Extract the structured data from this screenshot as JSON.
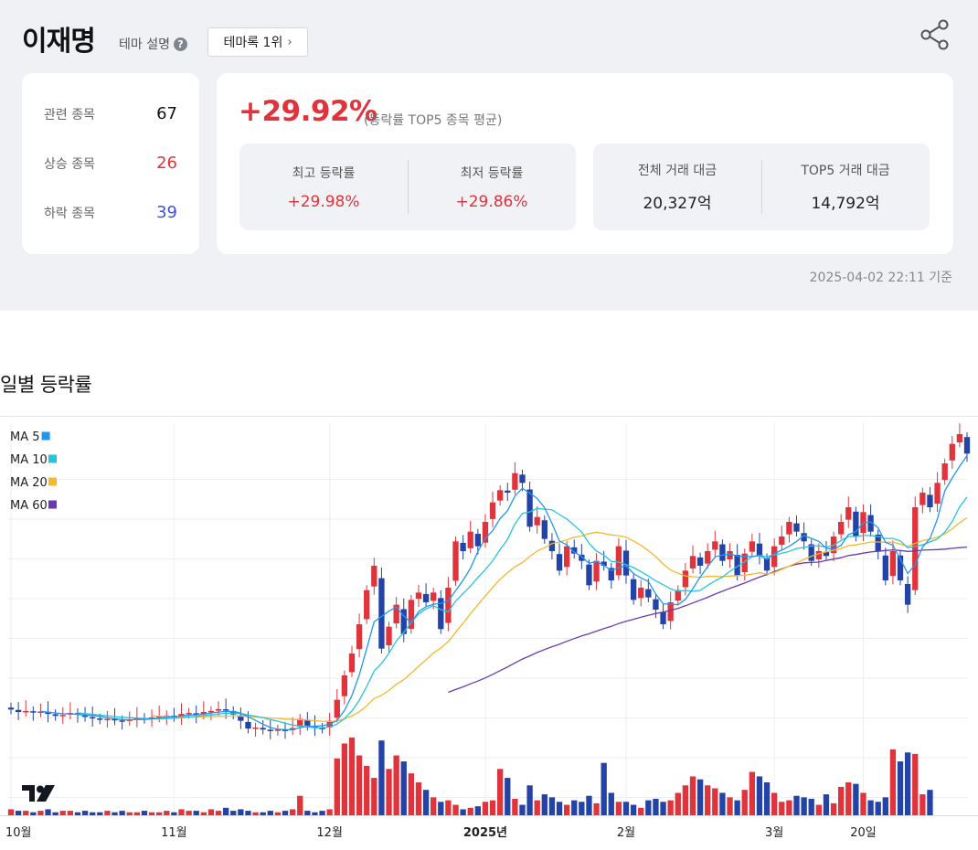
{
  "header": {
    "title": "이재명",
    "theme_desc": "테마 설명",
    "help_glyph": "?",
    "rank_button": "테마록 1위",
    "share_icon": "share-icon"
  },
  "stocks": {
    "related_label": "관련 종목",
    "related_value": "67",
    "up_label": "상승 종목",
    "up_value": "26",
    "down_label": "하락 종목",
    "down_value": "39"
  },
  "summary": {
    "avg_change": "+29.92%",
    "avg_note": "(등락률 TOP5 종목 평균)",
    "max_label": "최고 등락률",
    "max_value": "+29.98%",
    "min_label": "최저 등락률",
    "min_value": "+29.86%",
    "total_label": "전체 거래 대금",
    "total_value": "20,327억",
    "top5_label": "TOP5 거래 대금",
    "top5_value": "14,792억",
    "as_of": "2025-04-02 22:11 기준"
  },
  "colors": {
    "up": "#e0343c",
    "down": "#2443a6",
    "ma5": "#2196f3",
    "ma10": "#26c6da",
    "ma20": "#f5b82e",
    "ma60": "#6a3ab4"
  },
  "section_title": "일별 등락률",
  "chart_data": {
    "type": "candlestick+volume",
    "x_labels": [
      {
        "label": "10월",
        "index": 0
      },
      {
        "label": "11월",
        "index": 22
      },
      {
        "label": "12월",
        "index": 43
      },
      {
        "label": "2025년",
        "index": 64
      },
      {
        "label": "2월",
        "index": 83
      },
      {
        "label": "3월",
        "index": 103
      },
      {
        "label": "20일",
        "index": 115
      }
    ],
    "moving_averages": [
      {
        "name": "MA 5",
        "color": "#2196f3"
      },
      {
        "name": "MA 10",
        "color": "#26c6da"
      },
      {
        "name": "MA 20",
        "color": "#f5b82e"
      },
      {
        "name": "MA 60",
        "color": "#6a3ab4"
      }
    ],
    "y_range": [
      0,
      100
    ],
    "grid": true,
    "series_close": [
      3.5,
      3.0,
      3.2,
      2.9,
      3.1,
      2.6,
      2.2,
      2.4,
      2.8,
      2.5,
      2.0,
      1.7,
      1.5,
      1.6,
      1.3,
      1.1,
      1.5,
      1.8,
      1.6,
      1.9,
      2.1,
      2.3,
      2.0,
      2.6,
      2.8,
      2.4,
      3.0,
      3.2,
      3.6,
      3.3,
      2.5,
      1.2,
      -0.4,
      -0.2,
      -0.6,
      -0.9,
      -0.6,
      -0.8,
      -0.3,
      1.6,
      0.2,
      -0.2,
      -0.4,
      1.2,
      5.5,
      10.5,
      15.0,
      21.0,
      28.0,
      33.0,
      16.0,
      20.5,
      25.0,
      19.0,
      26.0,
      27.5,
      25.5,
      27.5,
      20.0,
      28.5,
      38.0,
      36.0,
      40.0,
      37.0,
      42.0,
      46.0,
      48.5,
      48.0,
      52.0,
      50.0,
      41.0,
      43.0,
      38.5,
      36.0,
      32.0,
      37.0,
      35.5,
      34.0,
      29.0,
      34.0,
      33.0,
      30.0,
      37.0,
      31.0,
      26.0,
      28.5,
      26.5,
      24.0,
      21.0,
      25.5,
      28.0,
      32.0,
      35.0,
      33.0,
      36.0,
      38.0,
      34.0,
      36.0,
      31.0,
      35.5,
      38.0,
      35.0,
      32.0,
      37.0,
      39.0,
      42.0,
      40.0,
      38.0,
      34.0,
      36.0,
      35.0,
      39.0,
      42.0,
      45.0,
      39.0,
      44.0,
      40.0,
      36.0,
      30.0,
      36.0,
      30.0,
      25.0,
      45.0,
      48.0,
      45.0,
      50.0,
      54.0,
      58.0,
      60.0,
      56.0
    ],
    "series_volume": [
      4,
      3,
      3,
      2,
      3,
      4,
      2,
      3,
      3,
      2,
      3,
      2,
      2,
      3,
      2,
      3,
      2,
      2,
      3,
      2,
      2,
      3,
      2,
      4,
      3,
      3,
      2,
      4,
      3,
      5,
      3,
      4,
      3,
      2,
      2,
      3,
      2,
      3,
      4,
      13,
      3,
      2,
      3,
      4,
      38,
      48,
      52,
      40,
      33,
      25,
      50,
      31,
      40,
      36,
      28,
      22,
      17,
      12,
      9,
      10,
      7,
      4,
      5,
      6,
      9,
      10,
      31,
      25,
      11,
      7,
      20,
      10,
      14,
      12,
      9,
      7,
      10,
      9,
      13,
      8,
      35,
      15,
      9,
      9,
      7,
      5,
      10,
      11,
      9,
      10,
      15,
      20,
      26,
      24,
      20,
      18,
      15,
      12,
      10,
      17,
      29,
      26,
      22,
      15,
      9,
      10,
      13,
      12,
      11,
      7,
      14,
      8,
      19,
      22,
      21,
      15,
      10,
      9,
      12,
      44,
      36,
      42,
      41,
      14,
      17
    ]
  }
}
